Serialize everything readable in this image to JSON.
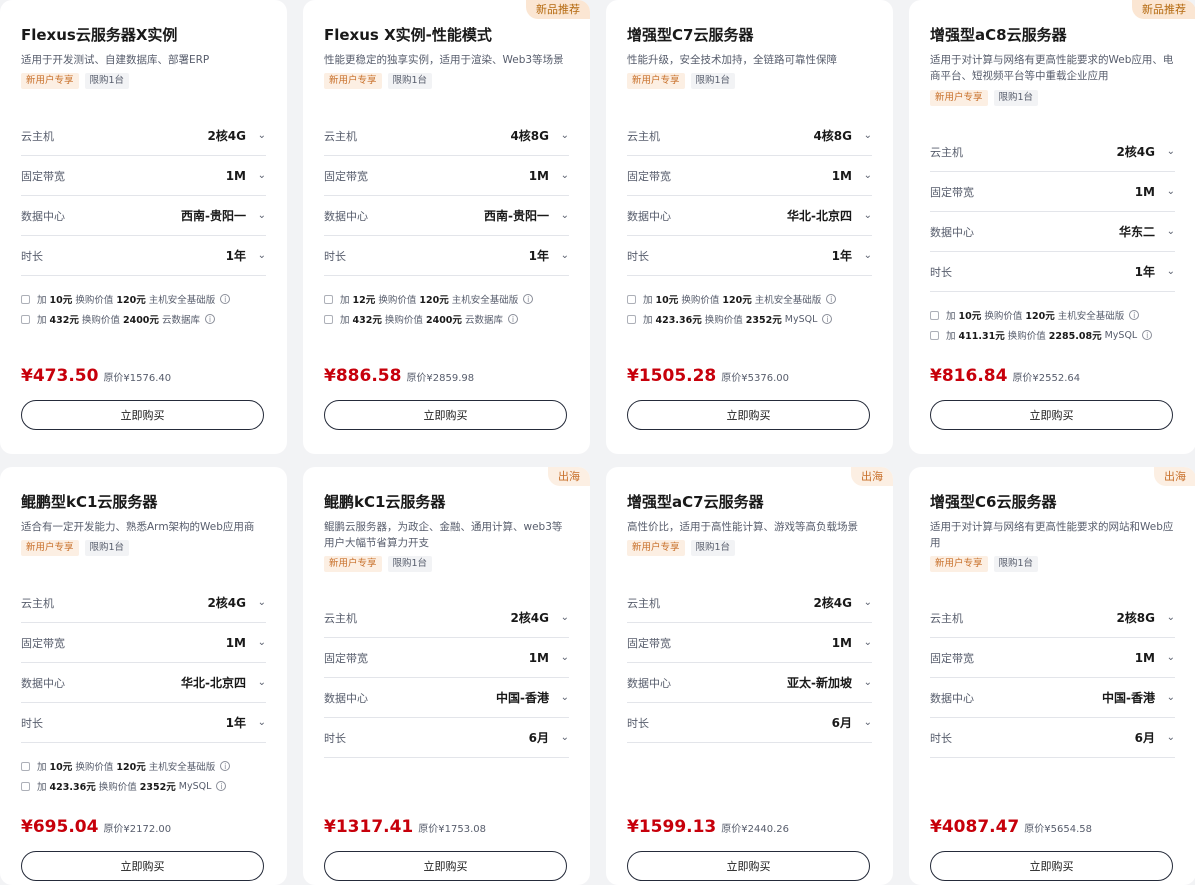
{
  "cards": [
    {
      "corner_tag": "",
      "title": "Flexus云服务器X实例",
      "desc": "适用于开发测试、自建数据库、部署ERP",
      "badges": [
        "新用户专享",
        "限购1台"
      ],
      "specs": [
        {
          "label": "云主机",
          "value": "2核4G"
        },
        {
          "label": "固定带宽",
          "value": "1M"
        },
        {
          "label": "数据中心",
          "value": "西南-贵阳一"
        },
        {
          "label": "时长",
          "value": "1年"
        }
      ],
      "addons": [
        {
          "prefix": "加",
          "amount": "10元",
          "mid": "换购价值",
          "worth": "120元",
          "product": "主机安全基础版"
        },
        {
          "prefix": "加",
          "amount": "432元",
          "mid": "换购价值",
          "worth": "2400元",
          "product": "云数据库"
        }
      ],
      "price": "¥473.50",
      "orig": "原价¥1576.40",
      "buy": "立即购买"
    },
    {
      "corner_tag": "新品推荐",
      "title": "Flexus X实例-性能模式",
      "desc": "性能更稳定的独享实例，适用于渲染、Web3等场景",
      "badges": [
        "新用户专享",
        "限购1台"
      ],
      "specs": [
        {
          "label": "云主机",
          "value": "4核8G"
        },
        {
          "label": "固定带宽",
          "value": "1M"
        },
        {
          "label": "数据中心",
          "value": "西南-贵阳一"
        },
        {
          "label": "时长",
          "value": "1年"
        }
      ],
      "addons": [
        {
          "prefix": "加",
          "amount": "12元",
          "mid": "换购价值",
          "worth": "120元",
          "product": "主机安全基础版"
        },
        {
          "prefix": "加",
          "amount": "432元",
          "mid": "换购价值",
          "worth": "2400元",
          "product": "云数据库"
        }
      ],
      "price": "¥886.58",
      "orig": "原价¥2859.98",
      "buy": "立即购买"
    },
    {
      "corner_tag": "",
      "title": "增强型C7云服务器",
      "desc": "性能升级，安全技术加持，全链路可靠性保障",
      "badges": [
        "新用户专享",
        "限购1台"
      ],
      "specs": [
        {
          "label": "云主机",
          "value": "4核8G"
        },
        {
          "label": "固定带宽",
          "value": "1M"
        },
        {
          "label": "数据中心",
          "value": "华北-北京四"
        },
        {
          "label": "时长",
          "value": "1年"
        }
      ],
      "addons": [
        {
          "prefix": "加",
          "amount": "10元",
          "mid": "换购价值",
          "worth": "120元",
          "product": "主机安全基础版"
        },
        {
          "prefix": "加",
          "amount": "423.36元",
          "mid": "换购价值",
          "worth": "2352元",
          "product": "MySQL"
        }
      ],
      "price": "¥1505.28",
      "orig": "原价¥5376.00",
      "buy": "立即购买"
    },
    {
      "corner_tag": "新品推荐",
      "title": "增强型aC8云服务器",
      "desc": "适用于对计算与网络有更高性能要求的Web应用、电商平台、短视频平台等中重载企业应用",
      "badges": [
        "新用户专享",
        "限购1台"
      ],
      "specs": [
        {
          "label": "云主机",
          "value": "2核4G"
        },
        {
          "label": "固定带宽",
          "value": "1M"
        },
        {
          "label": "数据中心",
          "value": "华东二"
        },
        {
          "label": "时长",
          "value": "1年"
        }
      ],
      "addons": [
        {
          "prefix": "加",
          "amount": "10元",
          "mid": "换购价值",
          "worth": "120元",
          "product": "主机安全基础版"
        },
        {
          "prefix": "加",
          "amount": "411.31元",
          "mid": "换购价值",
          "worth": "2285.08元",
          "product": "MySQL"
        }
      ],
      "price": "¥816.84",
      "orig": "原价¥2552.64",
      "buy": "立即购买"
    },
    {
      "corner_tag": "",
      "title": "鲲鹏型kC1云服务器",
      "desc": "适合有一定开发能力、熟悉Arm架构的Web应用商",
      "badges": [
        "新用户专享",
        "限购1台"
      ],
      "specs": [
        {
          "label": "云主机",
          "value": "2核4G"
        },
        {
          "label": "固定带宽",
          "value": "1M"
        },
        {
          "label": "数据中心",
          "value": "华北-北京四"
        },
        {
          "label": "时长",
          "value": "1年"
        }
      ],
      "addons": [
        {
          "prefix": "加",
          "amount": "10元",
          "mid": "换购价值",
          "worth": "120元",
          "product": "主机安全基础版"
        },
        {
          "prefix": "加",
          "amount": "423.36元",
          "mid": "换购价值",
          "worth": "2352元",
          "product": "MySQL"
        }
      ],
      "price": "¥695.04",
      "orig": "原价¥2172.00",
      "buy": "立即购买"
    },
    {
      "corner_tag": "出海",
      "title": "鲲鹏kC1云服务器",
      "desc": "鲲鹏云服务器，为政企、金融、通用计算、web3等用户大幅节省算力开支",
      "badges": [
        "新用户专享",
        "限购1台"
      ],
      "specs": [
        {
          "label": "云主机",
          "value": "2核4G"
        },
        {
          "label": "固定带宽",
          "value": "1M"
        },
        {
          "label": "数据中心",
          "value": "中国-香港"
        },
        {
          "label": "时长",
          "value": "6月"
        }
      ],
      "addons": [],
      "price": "¥1317.41",
      "orig": "原价¥1753.08",
      "buy": "立即购买"
    },
    {
      "corner_tag": "出海",
      "title": "增强型aC7云服务器",
      "desc": "高性价比，适用于高性能计算、游戏等高负载场景",
      "badges": [
        "新用户专享",
        "限购1台"
      ],
      "specs": [
        {
          "label": "云主机",
          "value": "2核4G"
        },
        {
          "label": "固定带宽",
          "value": "1M"
        },
        {
          "label": "数据中心",
          "value": "亚太-新加坡"
        },
        {
          "label": "时长",
          "value": "6月"
        }
      ],
      "addons": [],
      "price": "¥1599.13",
      "orig": "原价¥2440.26",
      "buy": "立即购买"
    },
    {
      "corner_tag": "出海",
      "title": "增强型C6云服务器",
      "desc": "适用于对计算与网络有更高性能要求的网站和Web应用",
      "badges": [
        "新用户专享",
        "限购1台"
      ],
      "specs": [
        {
          "label": "云主机",
          "value": "2核8G"
        },
        {
          "label": "固定带宽",
          "value": "1M"
        },
        {
          "label": "数据中心",
          "value": "中国-香港"
        },
        {
          "label": "时长",
          "value": "6月"
        }
      ],
      "addons": [],
      "price": "¥4087.47",
      "orig": "原价¥5654.58",
      "buy": "立即购买"
    }
  ],
  "icons": {
    "caret": "chevron-down-icon",
    "info": "info-icon"
  },
  "colors": {
    "price": "#c7000b",
    "badge_newuser_bg": "#fcefe3",
    "badge_newuser_text": "#c8702a",
    "tag_hot_bg": "#fbe6d3"
  }
}
